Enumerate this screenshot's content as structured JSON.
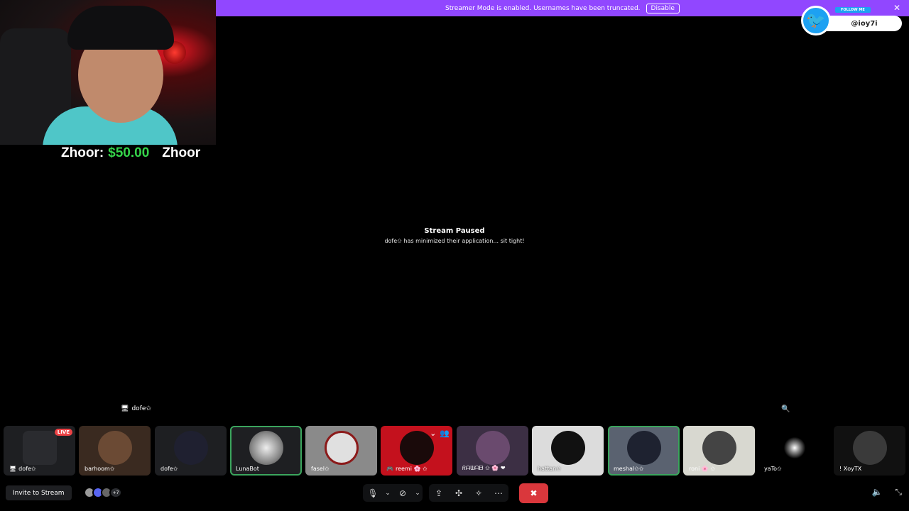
{
  "banner": {
    "message": "Streamer Mode is enabled. Usernames have been truncated.",
    "disable_label": "Disable",
    "close_icon": "close-icon"
  },
  "overlay": {
    "donation_name": "Zhoor:",
    "donation_amount": "$50.00",
    "donation_name_repeat": "Zhoor"
  },
  "twitter": {
    "follow_label": "FOLLOW ME",
    "handle": "@ioy7i"
  },
  "stream": {
    "title": "Stream Paused",
    "subtitle": "dofe✩ has minimized their application... sit tight!",
    "streamer_label": "dofe✩"
  },
  "participants": [
    {
      "name": "dofe✩",
      "live": "LIVE",
      "color": "#2a2b2f"
    },
    {
      "name": "barhoom✩",
      "color": "#6b4a34"
    },
    {
      "name": "dofe✩",
      "color": "#1f2030"
    },
    {
      "name": "LunaBot",
      "color": "#8e8e8e",
      "speaking": true
    },
    {
      "name": "fasel✩",
      "color": "#c9c9c9"
    },
    {
      "name": "reemi 🌸 ✩",
      "color": "#c4111d"
    },
    {
      "name": "ᖇᗩᗯᗩᗷ ✩ 🌸 ❤",
      "color": "#6a4a6e"
    },
    {
      "name": "hattan✩",
      "color": "#dcdcdc"
    },
    {
      "name": "meshal✩✩",
      "color": "#7f8a9a",
      "speaking": true
    },
    {
      "name": "roni 🌸 ✩",
      "color": "#d8d8d0"
    },
    {
      "name": "yaTo✩",
      "color": "#0d0d0d"
    },
    {
      "name": "! XoyTX",
      "color": "#2a2a2a"
    }
  ],
  "bottom": {
    "invite_label": "Invite to Stream",
    "watchers_more": "+7"
  },
  "colors": {
    "banner": "#9147ff",
    "live": "#ed4245",
    "end_call": "#da373c",
    "speaking": "#3ba55d"
  }
}
